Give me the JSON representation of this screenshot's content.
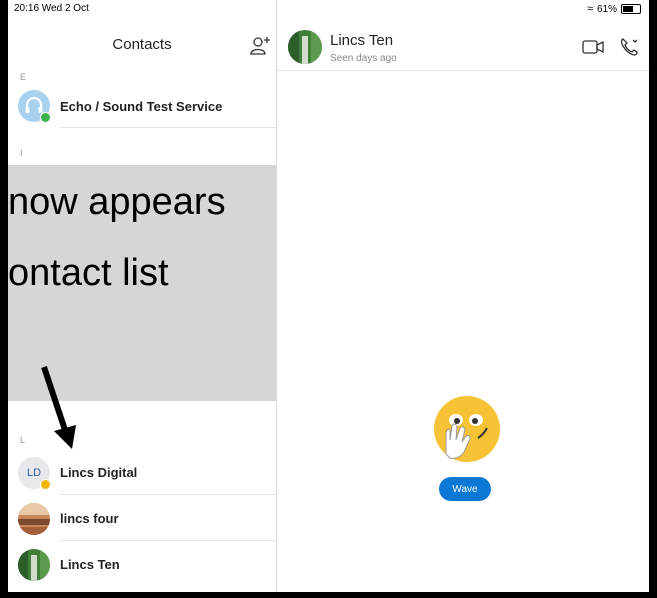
{
  "status_bar": {
    "time_date": "20:16  Wed 2 Oct",
    "battery": "61%"
  },
  "left_pane": {
    "title": "Contacts",
    "section_letters": [
      "E",
      "I",
      "L"
    ],
    "contacts": [
      {
        "name": "Echo / Sound Test Service",
        "presence": "online"
      },
      {
        "name": "Lincs Digital",
        "initials": "LD",
        "presence": "away"
      },
      {
        "name": "lincs four"
      },
      {
        "name": "Lincs Ten"
      }
    ]
  },
  "chat": {
    "contact_name": "Lincs Ten",
    "status": "Seen days ago",
    "wave_label": "Wave"
  },
  "overlay": {
    "line1": "now appears",
    "line2": "ontact list"
  },
  "colors": {
    "accent": "#0a78d4",
    "online": "#3cb44b",
    "away": "#f2b705",
    "overlay_bg": "#d6d6d6"
  }
}
